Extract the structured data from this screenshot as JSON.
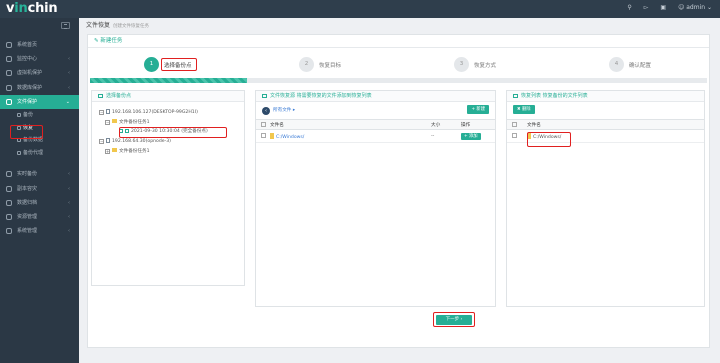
{
  "app": {
    "logo_a": "v",
    "logo_b": "in",
    "logo_c": "ch",
    "logo_d": "in",
    "user": "admin"
  },
  "sidebar": {
    "items": [
      {
        "label": "系统首页",
        "arrow": ""
      },
      {
        "label": "监控中心",
        "arrow": "‹"
      },
      {
        "label": "虚拟机保护",
        "arrow": "‹"
      },
      {
        "label": "数据库保护",
        "arrow": "‹"
      },
      {
        "label": "文件保护",
        "arrow": "⌄"
      }
    ],
    "subs": [
      {
        "label": "备份"
      },
      {
        "label": "恢复"
      },
      {
        "label": "备份数据"
      },
      {
        "label": "备份代理"
      }
    ],
    "items2": [
      {
        "label": "实时备份",
        "arrow": "‹"
      },
      {
        "label": "副本容灾",
        "arrow": "‹"
      },
      {
        "label": "数据归档",
        "arrow": "‹"
      },
      {
        "label": "资源管理",
        "arrow": "‹"
      },
      {
        "label": "系统管理",
        "arrow": "‹"
      }
    ]
  },
  "page": {
    "title": "文件恢复",
    "subtitle": "创建文件恢复任务",
    "card_title": "新建任务"
  },
  "steps": [
    {
      "num": "1",
      "label": "选择备份点"
    },
    {
      "num": "2",
      "label": "恢复目标"
    },
    {
      "num": "3",
      "label": "恢复方式"
    },
    {
      "num": "4",
      "label": "确认配置"
    }
  ],
  "left_panel": {
    "title": "选择备份点",
    "tree": {
      "host1": "192.168.106.127(DESKTOP-99G2H1I)",
      "job1": "文件备份任务1",
      "point1": "2021-09-30 10:30:04 (完全备份点)",
      "host2": "192.168.64.30(opnode-3)",
      "job2": "文件备份任务1"
    }
  },
  "mid_panel": {
    "title": "文件恢复源 将需要恢复的文件添加到恢复列表",
    "path": "所有文件 ▸",
    "new_btn": "+ 新建",
    "cols": [
      "文件名",
      "大小",
      "操作"
    ],
    "row": {
      "name": "C:/Windows/",
      "size": "--",
      "action": "+ 添加"
    }
  },
  "right_panel": {
    "title": "恢复列表 恢复备份的文件列表",
    "del_btn": "✖ 删除",
    "col": "文件名",
    "row": "C:/Windows/"
  },
  "footer": {
    "next": "下一步 ›"
  }
}
